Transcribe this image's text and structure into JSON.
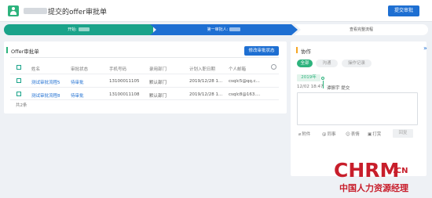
{
  "header": {
    "title": "提交的offer审批单",
    "submit_label": "提交审批"
  },
  "stepper": {
    "step1": "开始:",
    "step2": "第一审批人:",
    "step3": "查看完整流程"
  },
  "offer_panel": {
    "title": "Offer审批单",
    "modify_label": "修改审批状态",
    "columns": [
      "姓名",
      "审批状态",
      "手机号码",
      "录用部门",
      "计划入职日期",
      "个人邮箱"
    ],
    "rows": [
      [
        "测试审批流程5",
        "待审批",
        "13100011105",
        "默认部门",
        "2019/12/28 1...",
        "csqlc5@qq.c..."
      ],
      [
        "测试审批流程8",
        "待审批",
        "13100011108",
        "默认部门",
        "2019/12/28 1...",
        "csqlc8@163...."
      ]
    ],
    "total": "共2条"
  },
  "collab": {
    "title": "协作",
    "tabs": [
      "全部",
      "沟通",
      "操作记录"
    ],
    "year": "2019年",
    "log_time": "12/02 18:47",
    "log_text": "谭振宇 提交",
    "tools": [
      "附件",
      "同事",
      "表情",
      "打赏"
    ],
    "reply_label": "回复",
    "collapse_icon": "double-chevron-right-icon"
  },
  "brand": {
    "main": "CHRM",
    "suffix": ".CN",
    "cn": "中国人力资源经理"
  },
  "colors": {
    "accent_blue": "#1e6fd2",
    "accent_green": "#2db37d",
    "step_teal": "#1aa38a",
    "brand_red": "#c81e2b"
  }
}
